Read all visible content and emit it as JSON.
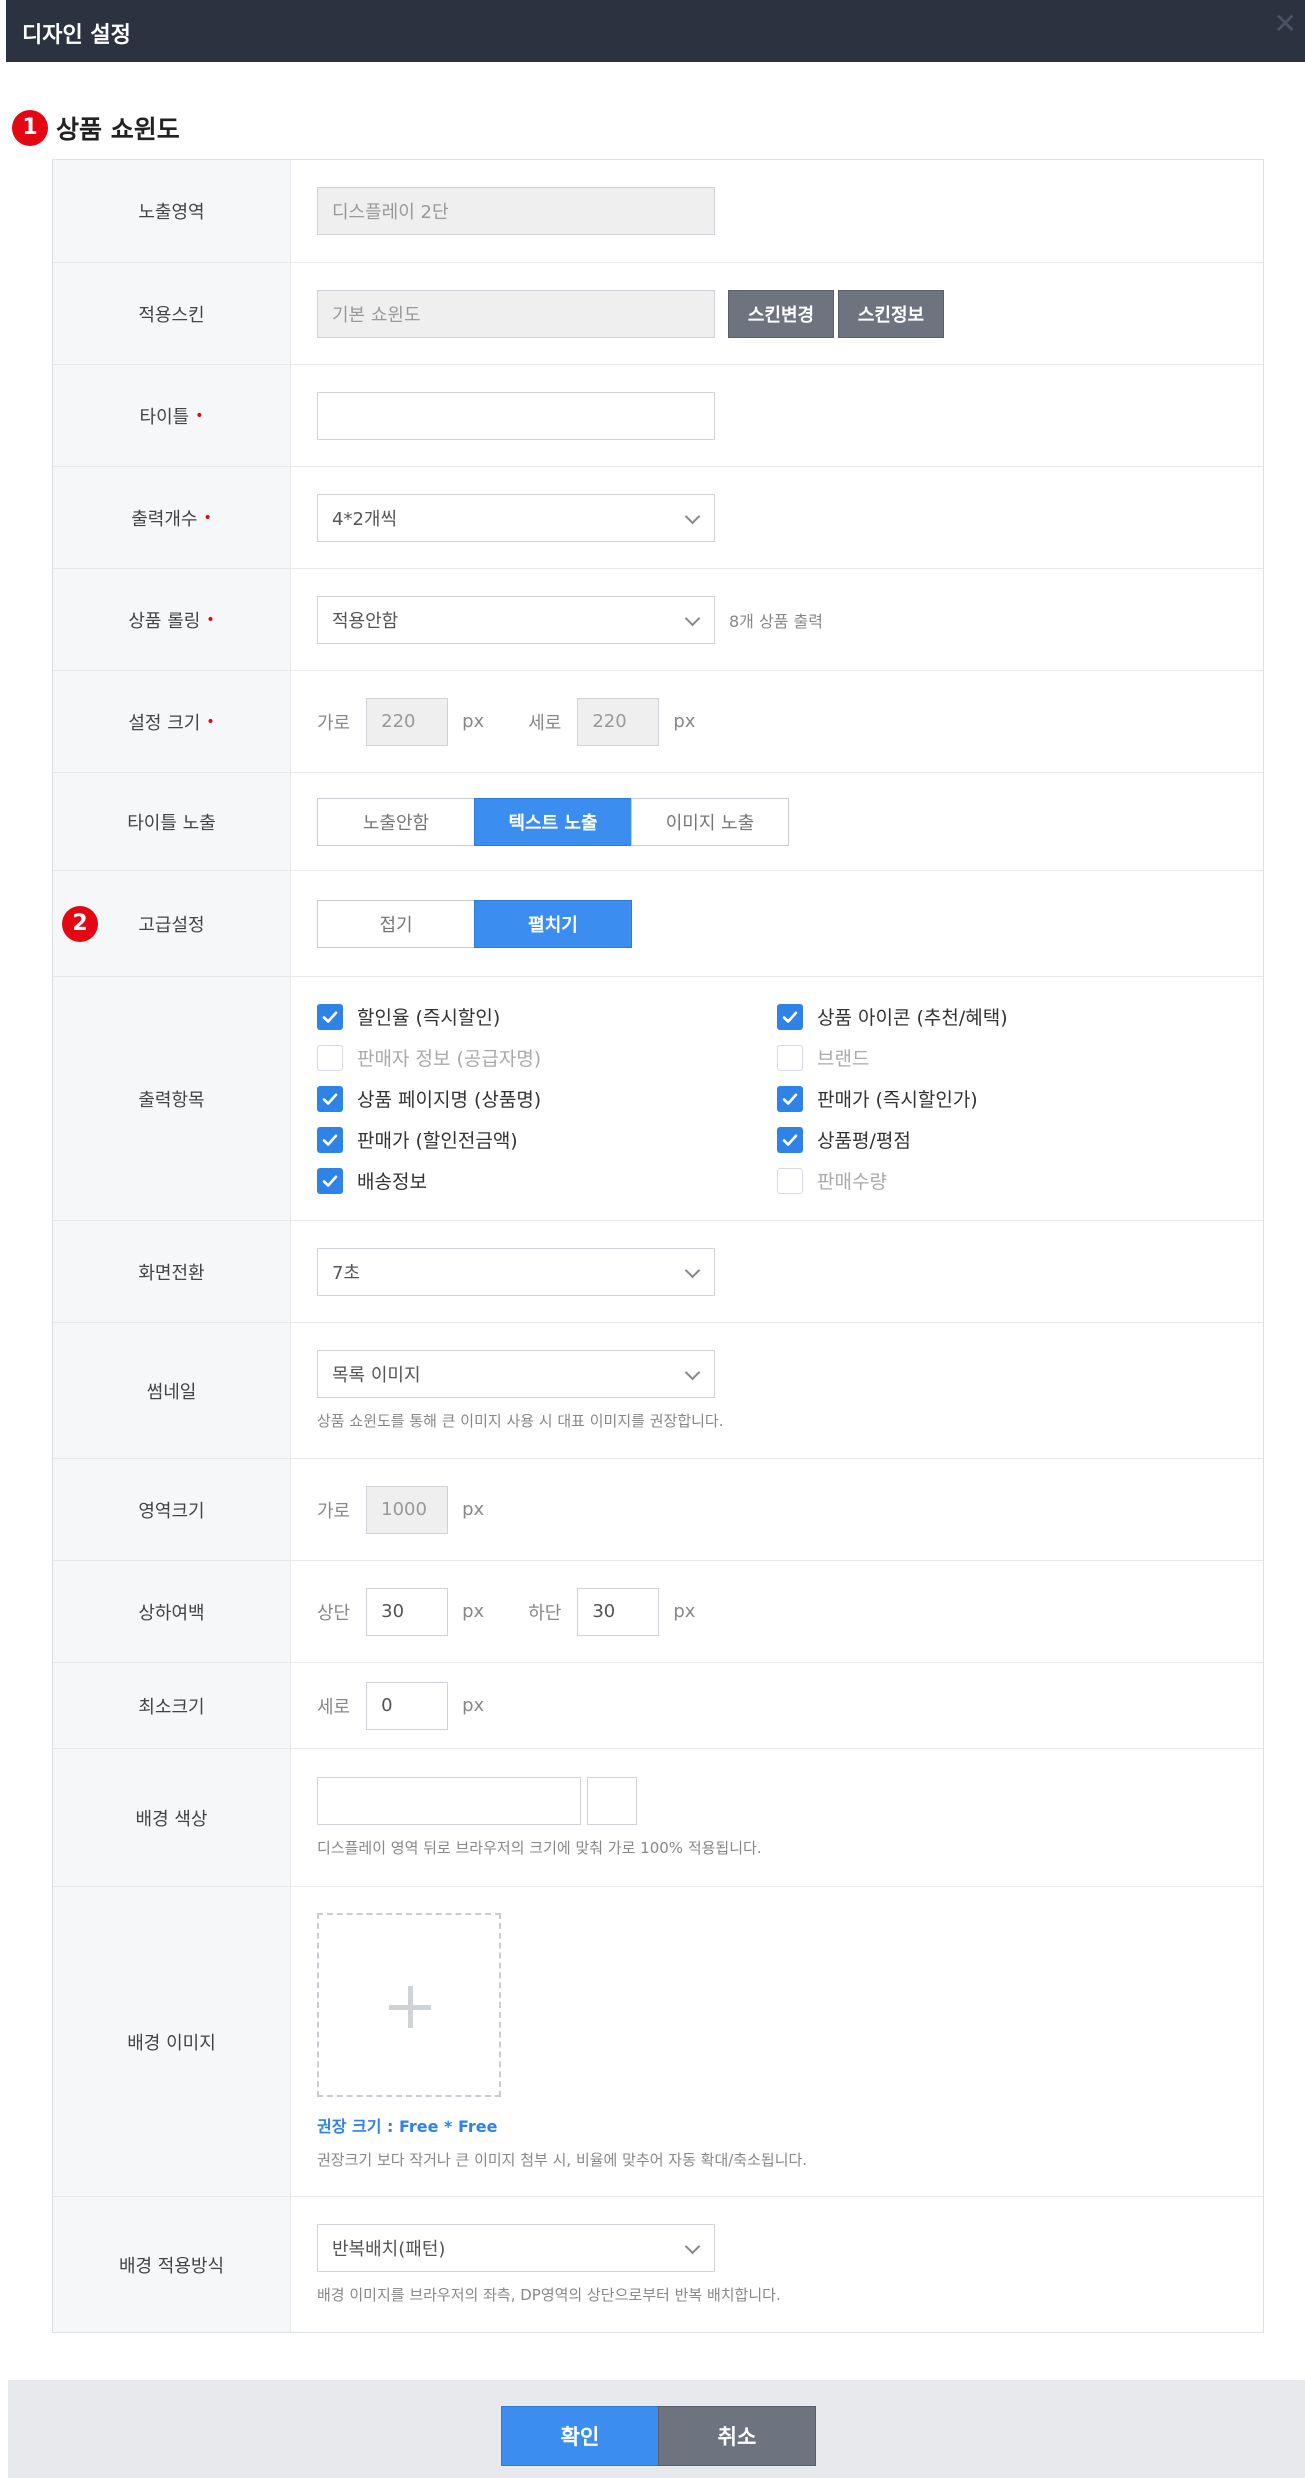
{
  "window": {
    "title": "디자인 설정",
    "close_icon": "close-icon"
  },
  "section": {
    "number": "1",
    "title": "상품 쇼윈도"
  },
  "form": {
    "display_area": {
      "label": "노출영역",
      "value": "디스플레이 2단"
    },
    "skin": {
      "label": "적용스킨",
      "value": "기본 쇼윈도",
      "change_button": "스킨변경",
      "info_button": "스킨정보"
    },
    "title": {
      "label": "타이틀",
      "required": "•",
      "value": ""
    },
    "output_count": {
      "label": "출력개수",
      "required": "•",
      "value": "4*2개씩"
    },
    "rolling": {
      "label": "상품 롤링",
      "required": "•",
      "value": "적용안함",
      "note": "8개 상품 출력"
    },
    "size": {
      "label": "설정 크기",
      "required": "•",
      "width_label": "가로",
      "width_value": "220",
      "height_label": "세로",
      "height_value": "220",
      "unit": "px"
    },
    "title_display": {
      "label": "타이틀 노출",
      "options": [
        "노출안함",
        "텍스트 노출",
        "이미지 노출"
      ],
      "selected": "텍스트 노출"
    },
    "advanced": {
      "number": "2",
      "label": "고급설정",
      "options": [
        "접기",
        "펼치기"
      ],
      "selected": "펼치기"
    },
    "output_items": {
      "label": "출력항목",
      "items": [
        {
          "label": "할인율 (즉시할인)",
          "checked": true
        },
        {
          "label": "상품 아이콘 (추천/혜택)",
          "checked": true
        },
        {
          "label": "판매자 정보 (공급자명)",
          "checked": false
        },
        {
          "label": "브랜드",
          "checked": false
        },
        {
          "label": "상품 페이지명 (상품명)",
          "checked": true
        },
        {
          "label": "판매가 (즉시할인가)",
          "checked": true
        },
        {
          "label": "판매가 (할인전금액)",
          "checked": true
        },
        {
          "label": "상품평/평점",
          "checked": true
        },
        {
          "label": "배송정보",
          "checked": true
        },
        {
          "label": "판매수량",
          "checked": false
        }
      ]
    },
    "transition": {
      "label": "화면전환",
      "value": "7초"
    },
    "thumbnail": {
      "label": "썸네일",
      "value": "목록 이미지",
      "hint": "상품 쇼윈도를 통해 큰 이미지 사용 시 대표 이미지를 권장합니다."
    },
    "area_size": {
      "label": "영역크기",
      "width_label": "가로",
      "width_value": "1000",
      "unit": "px"
    },
    "margin": {
      "label": "상하여백",
      "top_label": "상단",
      "top_value": "30",
      "bottom_label": "하단",
      "bottom_value": "30",
      "unit": "px"
    },
    "min_size": {
      "label": "최소크기",
      "height_label": "세로",
      "height_value": "0",
      "unit": "px"
    },
    "bg_color": {
      "label": "배경 색상",
      "value": "",
      "hint": "디스플레이 영역 뒤로 브라우저의 크기에 맞춰 가로 100% 적용됩니다."
    },
    "bg_image": {
      "label": "배경 이미지",
      "upload_icon": "plus-icon",
      "recommend": "권장 크기 : Free * Free",
      "hint": "권장크기 보다 작거나 큰 이미지 첨부 시, 비율에 맞추어 자동 확대/축소됩니다."
    },
    "bg_mode": {
      "label": "배경 적용방식",
      "value": "반복배치(패턴)",
      "hint": "배경 이미지를 브라우저의 좌측, DP영역의 상단으로부터 반복 배치합니다."
    }
  },
  "footer": {
    "confirm": "확인",
    "cancel": "취소"
  },
  "colors": {
    "primary": "#3b8ef0",
    "header": "#2c3340",
    "badge": "#e40613",
    "gray_button": "#6d7480"
  }
}
